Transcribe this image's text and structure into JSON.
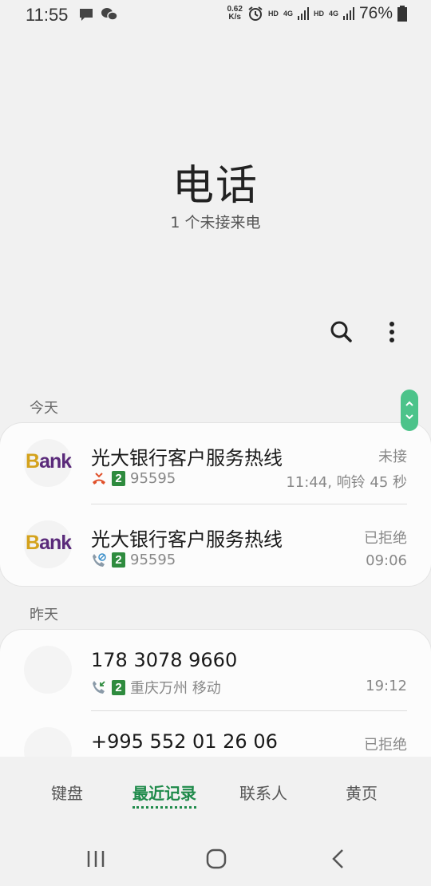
{
  "status_bar": {
    "time": "11:55",
    "net_speed_value": "0.62",
    "net_speed_unit": "K/s",
    "hd1": "HD",
    "lte1": "4G",
    "hd2": "HD",
    "lte2": "4G",
    "battery_percent": "76%"
  },
  "header": {
    "title": "电话",
    "subtitle": "1 个未接来电"
  },
  "sections": {
    "today_label": "今天",
    "yesterday_label": "昨天"
  },
  "today_calls": [
    {
      "name": "光大银行客户服务热线",
      "sim": "2",
      "number": "95595",
      "status": "未接",
      "time": "11:44, 响铃 45 秒",
      "avatar_text_initial": "B",
      "avatar_text_rest": "ank"
    },
    {
      "name": "光大银行客户服务热线",
      "sim": "2",
      "number": "95595",
      "status": "已拒绝",
      "time": "09:06",
      "avatar_text_initial": "B",
      "avatar_text_rest": "ank"
    }
  ],
  "yesterday_calls": [
    {
      "name": "178 3078 9660",
      "sim": "2",
      "location": "重庆万州 移动",
      "time": "19:12"
    },
    {
      "name": "+995 552 01 26 06",
      "status": "已拒绝"
    }
  ],
  "tabs": [
    {
      "label": "键盘"
    },
    {
      "label": "最近记录",
      "active": true
    },
    {
      "label": "联系人"
    },
    {
      "label": "黄页"
    }
  ],
  "colors": {
    "accent_green": "#1e8a4a",
    "missed_red": "#e0502a",
    "sim_badge_green": "#2e8b3e",
    "scroll_handle_green": "#4cc38a"
  }
}
